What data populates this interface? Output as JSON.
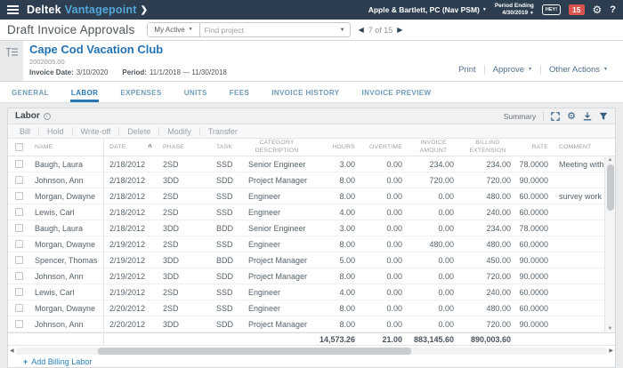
{
  "topbar": {
    "brand": "Deltek",
    "product": "Vantagepoint",
    "chevron": "❯",
    "company": "Apple & Bartlett, PC (Nav PSM)",
    "period_ending_label": "Period Ending",
    "period_ending_date": "4/30/2019",
    "chat_badge": "HEY!",
    "notification_count": "15",
    "help_label": "?"
  },
  "titlebar": {
    "page_title": "Draft Invoice Approvals",
    "scope_dropdown": "My Active",
    "search_placeholder": "Find project",
    "record_position": "7 of 15"
  },
  "project": {
    "name": "Cape Cod Vacation Club",
    "number": "2002005.00",
    "invoice_date_label": "Invoice Date:",
    "invoice_date": "3/10/2020",
    "period_label": "Period:",
    "period_range": "11/1/2018 — 11/30/2018",
    "print_label": "Print",
    "approve_label": "Approve",
    "other_actions_label": "Other Actions"
  },
  "tabs": [
    {
      "label": "GENERAL",
      "active": false
    },
    {
      "label": "LABOR",
      "active": true
    },
    {
      "label": "EXPENSES",
      "active": false
    },
    {
      "label": "UNITS",
      "active": false
    },
    {
      "label": "FEES",
      "active": false
    },
    {
      "label": "INVOICE HISTORY",
      "active": false
    },
    {
      "label": "INVOICE PREVIEW",
      "active": false
    }
  ],
  "labor": {
    "section_title": "Labor",
    "summary_label": "Summary",
    "toolbar": [
      "Bill",
      "Hold",
      "Write-off",
      "Delete",
      "Modify",
      "Transfer"
    ],
    "headers": {
      "name": "NAME",
      "date": "DATE",
      "phase": "PHASE",
      "task": "TASK",
      "category_line1": "CATEGORY",
      "category_line2": "DESCRIPTION",
      "hours": "HOURS",
      "overtime": "OVERTIME",
      "invoice_line1": "INVOICE",
      "invoice_line2": "AMOUNT",
      "billing_line1": "BILLING",
      "billing_line2": "EXTENSION",
      "rate": "RATE",
      "comment": "COMMENT"
    },
    "rows": [
      [
        "Baugh, Laura",
        "2/18/2012",
        "2SD",
        "SSD",
        "Senior Engineer",
        "3.00",
        "0.00",
        "234.00",
        "234.00",
        "78.0000",
        "Meeting with c"
      ],
      [
        "Johnson, Ann",
        "2/18/2012",
        "3DD",
        "SDD",
        "Project Manager",
        "8.00",
        "0.00",
        "720.00",
        "720.00",
        "90.0000",
        ""
      ],
      [
        "Morgan, Dwayne",
        "2/18/2012",
        "2SD",
        "SSD",
        "Engineer",
        "8.00",
        "0.00",
        "0.00",
        "480.00",
        "60.0000",
        "survey work re"
      ],
      [
        "Lewis, Carl",
        "2/18/2012",
        "2SD",
        "SSD",
        "Engineer",
        "4.00",
        "0.00",
        "0.00",
        "240.00",
        "60.0000",
        ""
      ],
      [
        "Baugh, Laura",
        "2/18/2012",
        "3DD",
        "BDD",
        "Senior Engineer",
        "3.00",
        "0.00",
        "0.00",
        "234.00",
        "78.0000",
        ""
      ],
      [
        "Morgan, Dwayne",
        "2/19/2012",
        "2SD",
        "SSD",
        "Engineer",
        "8.00",
        "0.00",
        "480.00",
        "480.00",
        "60.0000",
        ""
      ],
      [
        "Spencer, Thomas",
        "2/19/2012",
        "3DD",
        "BDD",
        "Project Manager",
        "5.00",
        "0.00",
        "0.00",
        "450.00",
        "90.0000",
        ""
      ],
      [
        "Johnson, Ann",
        "2/19/2012",
        "3DD",
        "SDD",
        "Project Manager",
        "8.00",
        "0.00",
        "0.00",
        "720.00",
        "90.0000",
        ""
      ],
      [
        "Lewis, Carl",
        "2/19/2012",
        "2SD",
        "SSD",
        "Engineer",
        "4.00",
        "0.00",
        "0.00",
        "240.00",
        "60.0000",
        ""
      ],
      [
        "Morgan, Dwayne",
        "2/20/2012",
        "2SD",
        "SSD",
        "Engineer",
        "8.00",
        "0.00",
        "0.00",
        "480.00",
        "60.0000",
        ""
      ],
      [
        "Johnson, Ann",
        "2/20/2012",
        "3DD",
        "SDD",
        "Project Manager",
        "8.00",
        "0.00",
        "0.00",
        "720.00",
        "90.0000",
        ""
      ]
    ],
    "totals": {
      "hours": "14,573.26",
      "overtime": "21.00",
      "invoice_amount": "883,145.60",
      "billing_extension": "890,003.60"
    },
    "add_link": "Add Billing Labor"
  },
  "colors": {
    "topbar_bg": "#2d3e50",
    "accent_blue": "#54a7db",
    "active_tab_blue": "#2577b5",
    "link_blue": "#2273b5",
    "badge_red": "#d9534f"
  }
}
